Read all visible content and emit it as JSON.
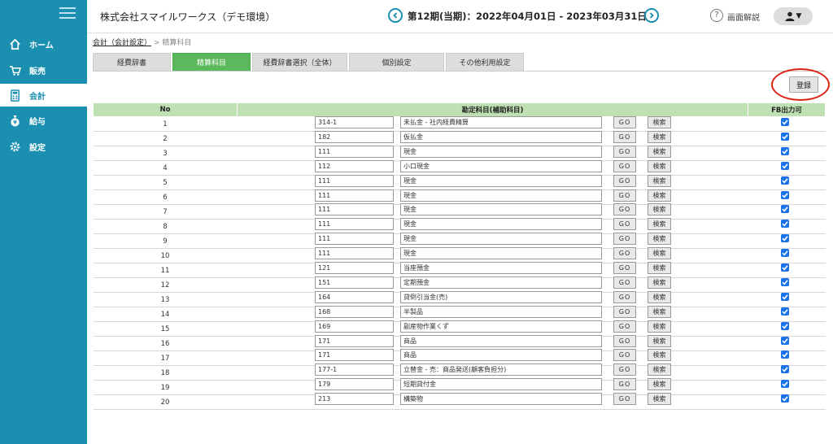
{
  "sidebar": {
    "items": [
      {
        "label": "ホーム",
        "icon": "home-icon"
      },
      {
        "label": "販売",
        "icon": "cart-icon"
      },
      {
        "label": "会計",
        "icon": "calculator-icon",
        "active": true
      },
      {
        "label": "給与",
        "icon": "money-bag-icon"
      },
      {
        "label": "設定",
        "icon": "gear-icon"
      }
    ]
  },
  "header": {
    "company": "株式会社スマイルワークス（デモ環境）",
    "period": "第12期(当期)：2022年04月01日 - 2023年03月31日",
    "help_label": "画面解説",
    "help_glyph": "?"
  },
  "breadcrumb": {
    "link": "会計（会計設定）",
    "separator": ">",
    "current": "精算科目"
  },
  "tabs": [
    {
      "label": "経費辞書"
    },
    {
      "label": "精算科目",
      "active": true
    },
    {
      "label": "経費辞書選択（全体）"
    },
    {
      "label": "個別設定"
    },
    {
      "label": "その他利用設定"
    }
  ],
  "register_label": "登録",
  "table": {
    "headers": {
      "no": "No",
      "account": "勘定科目(補助科目)",
      "fb": "FB出力可"
    },
    "go_label": "GO",
    "search_label": "検索",
    "rows": [
      {
        "no": "1",
        "code": "314-1",
        "name": "未払金 - 社内経費精算",
        "fb": true
      },
      {
        "no": "2",
        "code": "182",
        "name": "仮払金",
        "fb": true
      },
      {
        "no": "3",
        "code": "111",
        "name": "現金",
        "fb": true
      },
      {
        "no": "4",
        "code": "112",
        "name": "小口現金",
        "fb": true
      },
      {
        "no": "5",
        "code": "111",
        "name": "現金",
        "fb": true
      },
      {
        "no": "6",
        "code": "111",
        "name": "現金",
        "fb": true
      },
      {
        "no": "7",
        "code": "111",
        "name": "現金",
        "fb": true
      },
      {
        "no": "8",
        "code": "111",
        "name": "現金",
        "fb": true
      },
      {
        "no": "9",
        "code": "111",
        "name": "現金",
        "fb": true
      },
      {
        "no": "10",
        "code": "111",
        "name": "現金",
        "fb": true
      },
      {
        "no": "11",
        "code": "121",
        "name": "当座預金",
        "fb": true
      },
      {
        "no": "12",
        "code": "151",
        "name": "定期預金",
        "fb": true
      },
      {
        "no": "13",
        "code": "164",
        "name": "貸倒引当金(売)",
        "fb": true
      },
      {
        "no": "14",
        "code": "168",
        "name": "半製品",
        "fb": true
      },
      {
        "no": "15",
        "code": "169",
        "name": "副産物作業くず",
        "fb": true
      },
      {
        "no": "16",
        "code": "171",
        "name": "商品",
        "fb": true
      },
      {
        "no": "17",
        "code": "171",
        "name": "商品",
        "fb": true
      },
      {
        "no": "18",
        "code": "177-1",
        "name": "立替金 - 売：商品発送(顧客負担分)",
        "fb": true
      },
      {
        "no": "19",
        "code": "179",
        "name": "短期貸付金",
        "fb": true
      },
      {
        "no": "20",
        "code": "213",
        "name": "構築物",
        "fb": true
      }
    ]
  }
}
